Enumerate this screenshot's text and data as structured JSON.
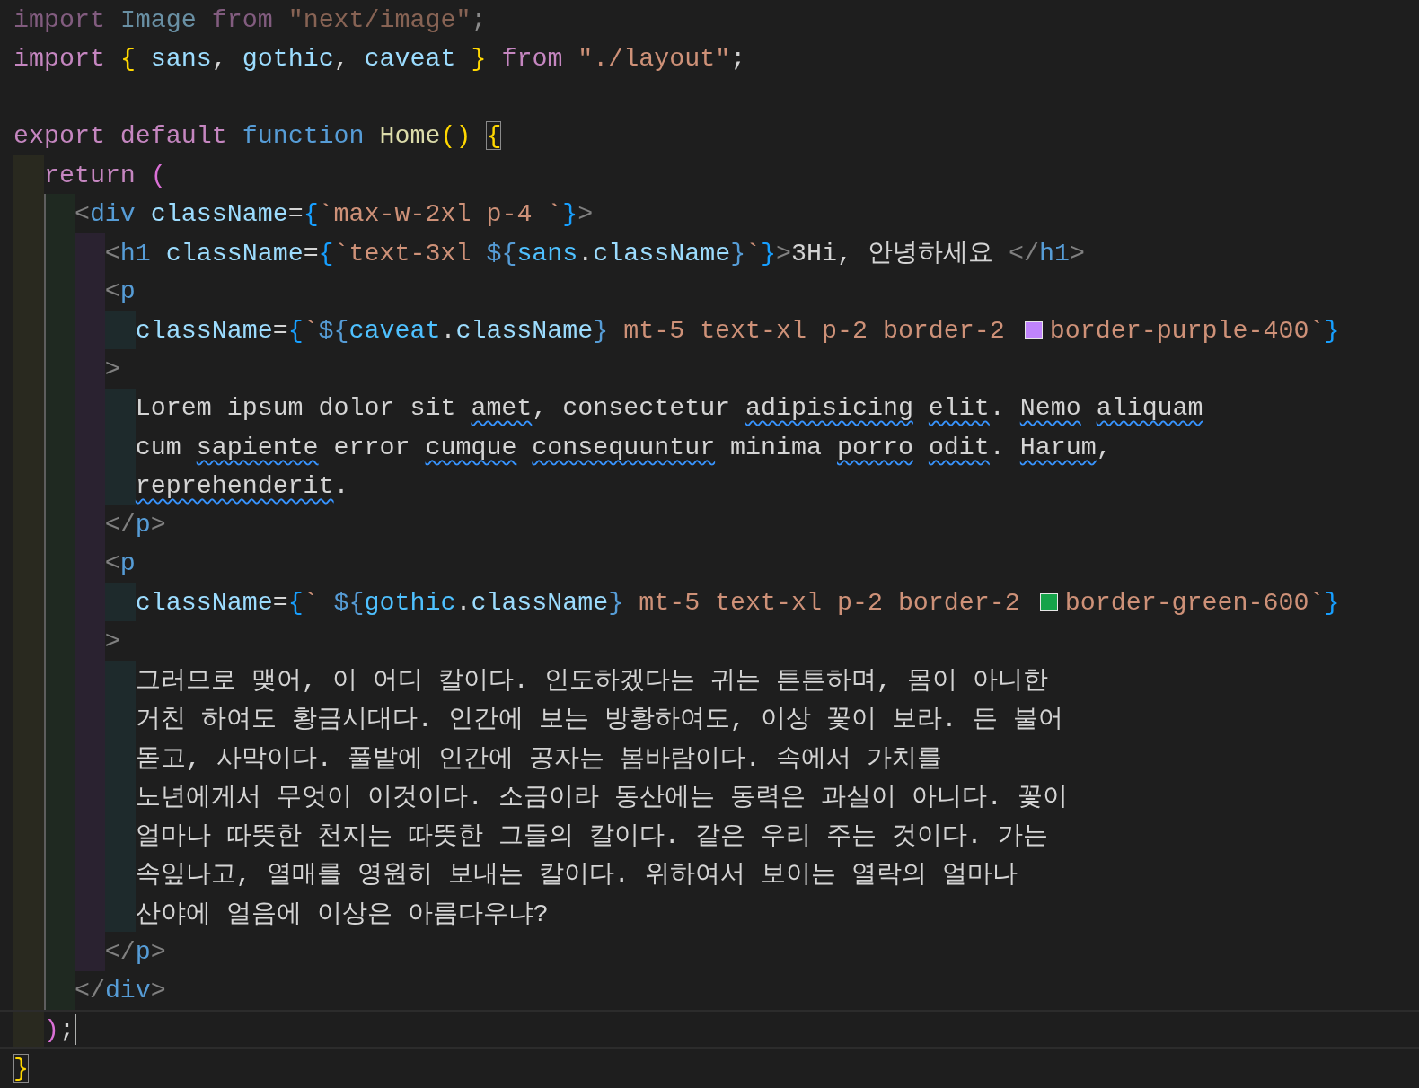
{
  "editor": {
    "lines": [
      {
        "kind": "code",
        "tokens": [
          {
            "kind": "kw-dim",
            "text": "import "
          },
          {
            "kind": "var-dim",
            "text": "Image "
          },
          {
            "kind": "kw-dim",
            "text": "from "
          },
          {
            "kind": "str-dim",
            "text": "\"next/image\""
          },
          {
            "kind": "punct-dim",
            "text": ";"
          }
        ]
      },
      {
        "kind": "code",
        "tokens": [
          {
            "kind": "kw",
            "text": "import "
          },
          {
            "kind": "br1",
            "text": "{ "
          },
          {
            "kind": "var",
            "text": "sans"
          },
          {
            "kind": "punct",
            "text": ", "
          },
          {
            "kind": "var",
            "text": "gothic"
          },
          {
            "kind": "punct",
            "text": ", "
          },
          {
            "kind": "var",
            "text": "caveat "
          },
          {
            "kind": "br1",
            "text": "} "
          },
          {
            "kind": "kw",
            "text": "from "
          },
          {
            "kind": "str",
            "text": "\"./layout\""
          },
          {
            "kind": "punct",
            "text": ";"
          }
        ]
      },
      {
        "kind": "blank"
      },
      {
        "kind": "code",
        "tokens": [
          {
            "kind": "kw",
            "text": "export default "
          },
          {
            "kind": "storage",
            "text": "function "
          },
          {
            "kind": "fn",
            "text": "Home"
          },
          {
            "kind": "br1",
            "text": "() "
          },
          {
            "kind": "br1-match",
            "text": "{"
          }
        ],
        "children": [
          {
            "kind": "code",
            "tokens": [
              {
                "kind": "kw",
                "text": "return "
              },
              {
                "kind": "br2",
                "text": "("
              }
            ],
            "children": [
              {
                "kind": "code",
                "tokens": [
                  {
                    "kind": "tag",
                    "text": "<"
                  },
                  {
                    "kind": "tagname",
                    "text": "div "
                  },
                  {
                    "kind": "attr",
                    "text": "className"
                  },
                  {
                    "kind": "punct",
                    "text": "="
                  },
                  {
                    "kind": "br3",
                    "text": "{"
                  },
                  {
                    "kind": "str",
                    "text": "`max-w-2xl p-4 `"
                  },
                  {
                    "kind": "br3",
                    "text": "}"
                  },
                  {
                    "kind": "tag",
                    "text": ">"
                  }
                ],
                "children": [
                  {
                    "kind": "code",
                    "tokens": [
                      {
                        "kind": "tag",
                        "text": "<"
                      },
                      {
                        "kind": "tagname",
                        "text": "h1 "
                      },
                      {
                        "kind": "attr",
                        "text": "className"
                      },
                      {
                        "kind": "punct",
                        "text": "="
                      },
                      {
                        "kind": "br3",
                        "text": "{"
                      },
                      {
                        "kind": "str",
                        "text": "`text-3xl "
                      },
                      {
                        "kind": "tpl",
                        "text": "${"
                      },
                      {
                        "kind": "const",
                        "text": "sans"
                      },
                      {
                        "kind": "punct",
                        "text": "."
                      },
                      {
                        "kind": "var",
                        "text": "className"
                      },
                      {
                        "kind": "tpl",
                        "text": "}"
                      },
                      {
                        "kind": "str",
                        "text": "`"
                      },
                      {
                        "kind": "br3",
                        "text": "}"
                      },
                      {
                        "kind": "tag",
                        "text": ">"
                      },
                      {
                        "kind": "text",
                        "text": "3Hi, 안녕하세요 "
                      },
                      {
                        "kind": "tag",
                        "text": "</"
                      },
                      {
                        "kind": "tagname",
                        "text": "h1"
                      },
                      {
                        "kind": "tag",
                        "text": ">"
                      }
                    ]
                  },
                  {
                    "kind": "code",
                    "tokens": [
                      {
                        "kind": "tag",
                        "text": "<"
                      },
                      {
                        "kind": "tagname",
                        "text": "p"
                      }
                    ],
                    "children": [
                      {
                        "kind": "code",
                        "tokens": [
                          {
                            "kind": "attr",
                            "text": "className"
                          },
                          {
                            "kind": "punct",
                            "text": "="
                          },
                          {
                            "kind": "br3",
                            "text": "{"
                          },
                          {
                            "kind": "str",
                            "text": "`"
                          },
                          {
                            "kind": "tpl",
                            "text": "${"
                          },
                          {
                            "kind": "const",
                            "text": "caveat"
                          },
                          {
                            "kind": "punct",
                            "text": "."
                          },
                          {
                            "kind": "var",
                            "text": "className"
                          },
                          {
                            "kind": "tpl",
                            "text": "}"
                          },
                          {
                            "kind": "str",
                            "text": " mt-5 text-xl p-2 border-2"
                          },
                          {
                            "kind": "swatch",
                            "color": "#c084fc"
                          },
                          {
                            "kind": "str",
                            "text": "border-purple-400`"
                          },
                          {
                            "kind": "br3",
                            "text": "}"
                          }
                        ]
                      }
                    ]
                  },
                  {
                    "kind": "code",
                    "tokens": [
                      {
                        "kind": "tag",
                        "text": ">"
                      }
                    ],
                    "children": [
                      {
                        "kind": "code",
                        "tokens": [
                          {
                            "kind": "text",
                            "text": "Lorem ipsum dolor sit "
                          },
                          {
                            "kind": "misspelled",
                            "text": "amet"
                          },
                          {
                            "kind": "text",
                            "text": ", consectetur "
                          },
                          {
                            "kind": "misspelled",
                            "text": "adipisicing "
                          },
                          {
                            "kind": "misspelled",
                            "text": "elit"
                          },
                          {
                            "kind": "text",
                            "text": ". "
                          },
                          {
                            "kind": "misspelled",
                            "text": "Nemo "
                          },
                          {
                            "kind": "misspelled",
                            "text": "aliquam"
                          }
                        ]
                      },
                      {
                        "kind": "code",
                        "tokens": [
                          {
                            "kind": "text",
                            "text": "cum "
                          },
                          {
                            "kind": "misspelled",
                            "text": "sapiente"
                          },
                          {
                            "kind": "text",
                            "text": " error "
                          },
                          {
                            "kind": "misspelled",
                            "text": "cumque "
                          },
                          {
                            "kind": "misspelled",
                            "text": "consequuntur"
                          },
                          {
                            "kind": "text",
                            "text": " minima "
                          },
                          {
                            "kind": "misspelled",
                            "text": "porro "
                          },
                          {
                            "kind": "misspelled",
                            "text": "odit"
                          },
                          {
                            "kind": "text",
                            "text": ". "
                          },
                          {
                            "kind": "misspelled",
                            "text": "Harum"
                          },
                          {
                            "kind": "text",
                            "text": ","
                          }
                        ]
                      },
                      {
                        "kind": "code",
                        "tokens": [
                          {
                            "kind": "misspelled",
                            "text": "reprehenderit"
                          },
                          {
                            "kind": "text",
                            "text": "."
                          }
                        ]
                      }
                    ]
                  },
                  {
                    "kind": "code",
                    "tokens": [
                      {
                        "kind": "tag",
                        "text": "</"
                      },
                      {
                        "kind": "tagname",
                        "text": "p"
                      },
                      {
                        "kind": "tag",
                        "text": ">"
                      }
                    ]
                  },
                  {
                    "kind": "code",
                    "tokens": [
                      {
                        "kind": "tag",
                        "text": "<"
                      },
                      {
                        "kind": "tagname",
                        "text": "p"
                      }
                    ],
                    "children": [
                      {
                        "kind": "code",
                        "tokens": [
                          {
                            "kind": "attr",
                            "text": "className"
                          },
                          {
                            "kind": "punct",
                            "text": "="
                          },
                          {
                            "kind": "br3",
                            "text": "{"
                          },
                          {
                            "kind": "str",
                            "text": "` "
                          },
                          {
                            "kind": "tpl",
                            "text": "${"
                          },
                          {
                            "kind": "const",
                            "text": "gothic"
                          },
                          {
                            "kind": "punct",
                            "text": "."
                          },
                          {
                            "kind": "var",
                            "text": "className"
                          },
                          {
                            "kind": "tpl",
                            "text": "}"
                          },
                          {
                            "kind": "str",
                            "text": " mt-5 text-xl p-2 border-2"
                          },
                          {
                            "kind": "swatch",
                            "color": "#16a34a"
                          },
                          {
                            "kind": "str",
                            "text": "border-green-600`"
                          },
                          {
                            "kind": "br3",
                            "text": "}"
                          }
                        ]
                      }
                    ]
                  },
                  {
                    "kind": "code",
                    "tokens": [
                      {
                        "kind": "tag",
                        "text": ">"
                      }
                    ],
                    "children": [
                      {
                        "kind": "code",
                        "tokens": [
                          {
                            "kind": "text",
                            "text": "그러므로 맺어, 이 어디 칼이다. 인도하겠다는 귀는 튼튼하며, 몸이 아니한"
                          }
                        ]
                      },
                      {
                        "kind": "code",
                        "tokens": [
                          {
                            "kind": "text",
                            "text": "거친 하여도 황금시대다. 인간에 보는 방황하여도, 이상 꽃이 보라. 든 불어"
                          }
                        ]
                      },
                      {
                        "kind": "code",
                        "tokens": [
                          {
                            "kind": "text",
                            "text": "돋고, 사막이다. 풀밭에 인간에 공자는 봄바람이다. 속에서 가치를"
                          }
                        ]
                      },
                      {
                        "kind": "code",
                        "tokens": [
                          {
                            "kind": "text",
                            "text": "노년에게서 무엇이 이것이다. 소금이라 동산에는 동력은 과실이 아니다. 꽃이"
                          }
                        ]
                      },
                      {
                        "kind": "code",
                        "tokens": [
                          {
                            "kind": "text",
                            "text": "얼마나 따뜻한 천지는 따뜻한 그들의 칼이다. 같은 우리 주는 것이다. 가는"
                          }
                        ]
                      },
                      {
                        "kind": "code",
                        "tokens": [
                          {
                            "kind": "text",
                            "text": "속잎나고, 열매를 영원히 보내는 칼이다. 위하여서 보이는 열락의 얼마나"
                          }
                        ]
                      },
                      {
                        "kind": "code",
                        "tokens": [
                          {
                            "kind": "text",
                            "text": "산야에 얼음에 이상은 아름다우냐?"
                          }
                        ]
                      }
                    ]
                  },
                  {
                    "kind": "code",
                    "tokens": [
                      {
                        "kind": "tag",
                        "text": "</"
                      },
                      {
                        "kind": "tagname",
                        "text": "p"
                      },
                      {
                        "kind": "tag",
                        "text": ">"
                      }
                    ]
                  }
                ]
              },
              {
                "kind": "code",
                "tokens": [
                  {
                    "kind": "tag",
                    "text": "</"
                  },
                  {
                    "kind": "tagname",
                    "text": "div"
                  },
                  {
                    "kind": "tag",
                    "text": ">"
                  }
                ]
              }
            ]
          },
          {
            "kind": "code",
            "tokens": [
              {
                "kind": "br2",
                "text": ")"
              },
              {
                "kind": "punct",
                "text": ";"
              },
              {
                "kind": "cursor"
              }
            ]
          }
        ]
      },
      {
        "kind": "code",
        "tokens": [
          {
            "kind": "br1-match",
            "text": "}"
          }
        ]
      }
    ]
  }
}
